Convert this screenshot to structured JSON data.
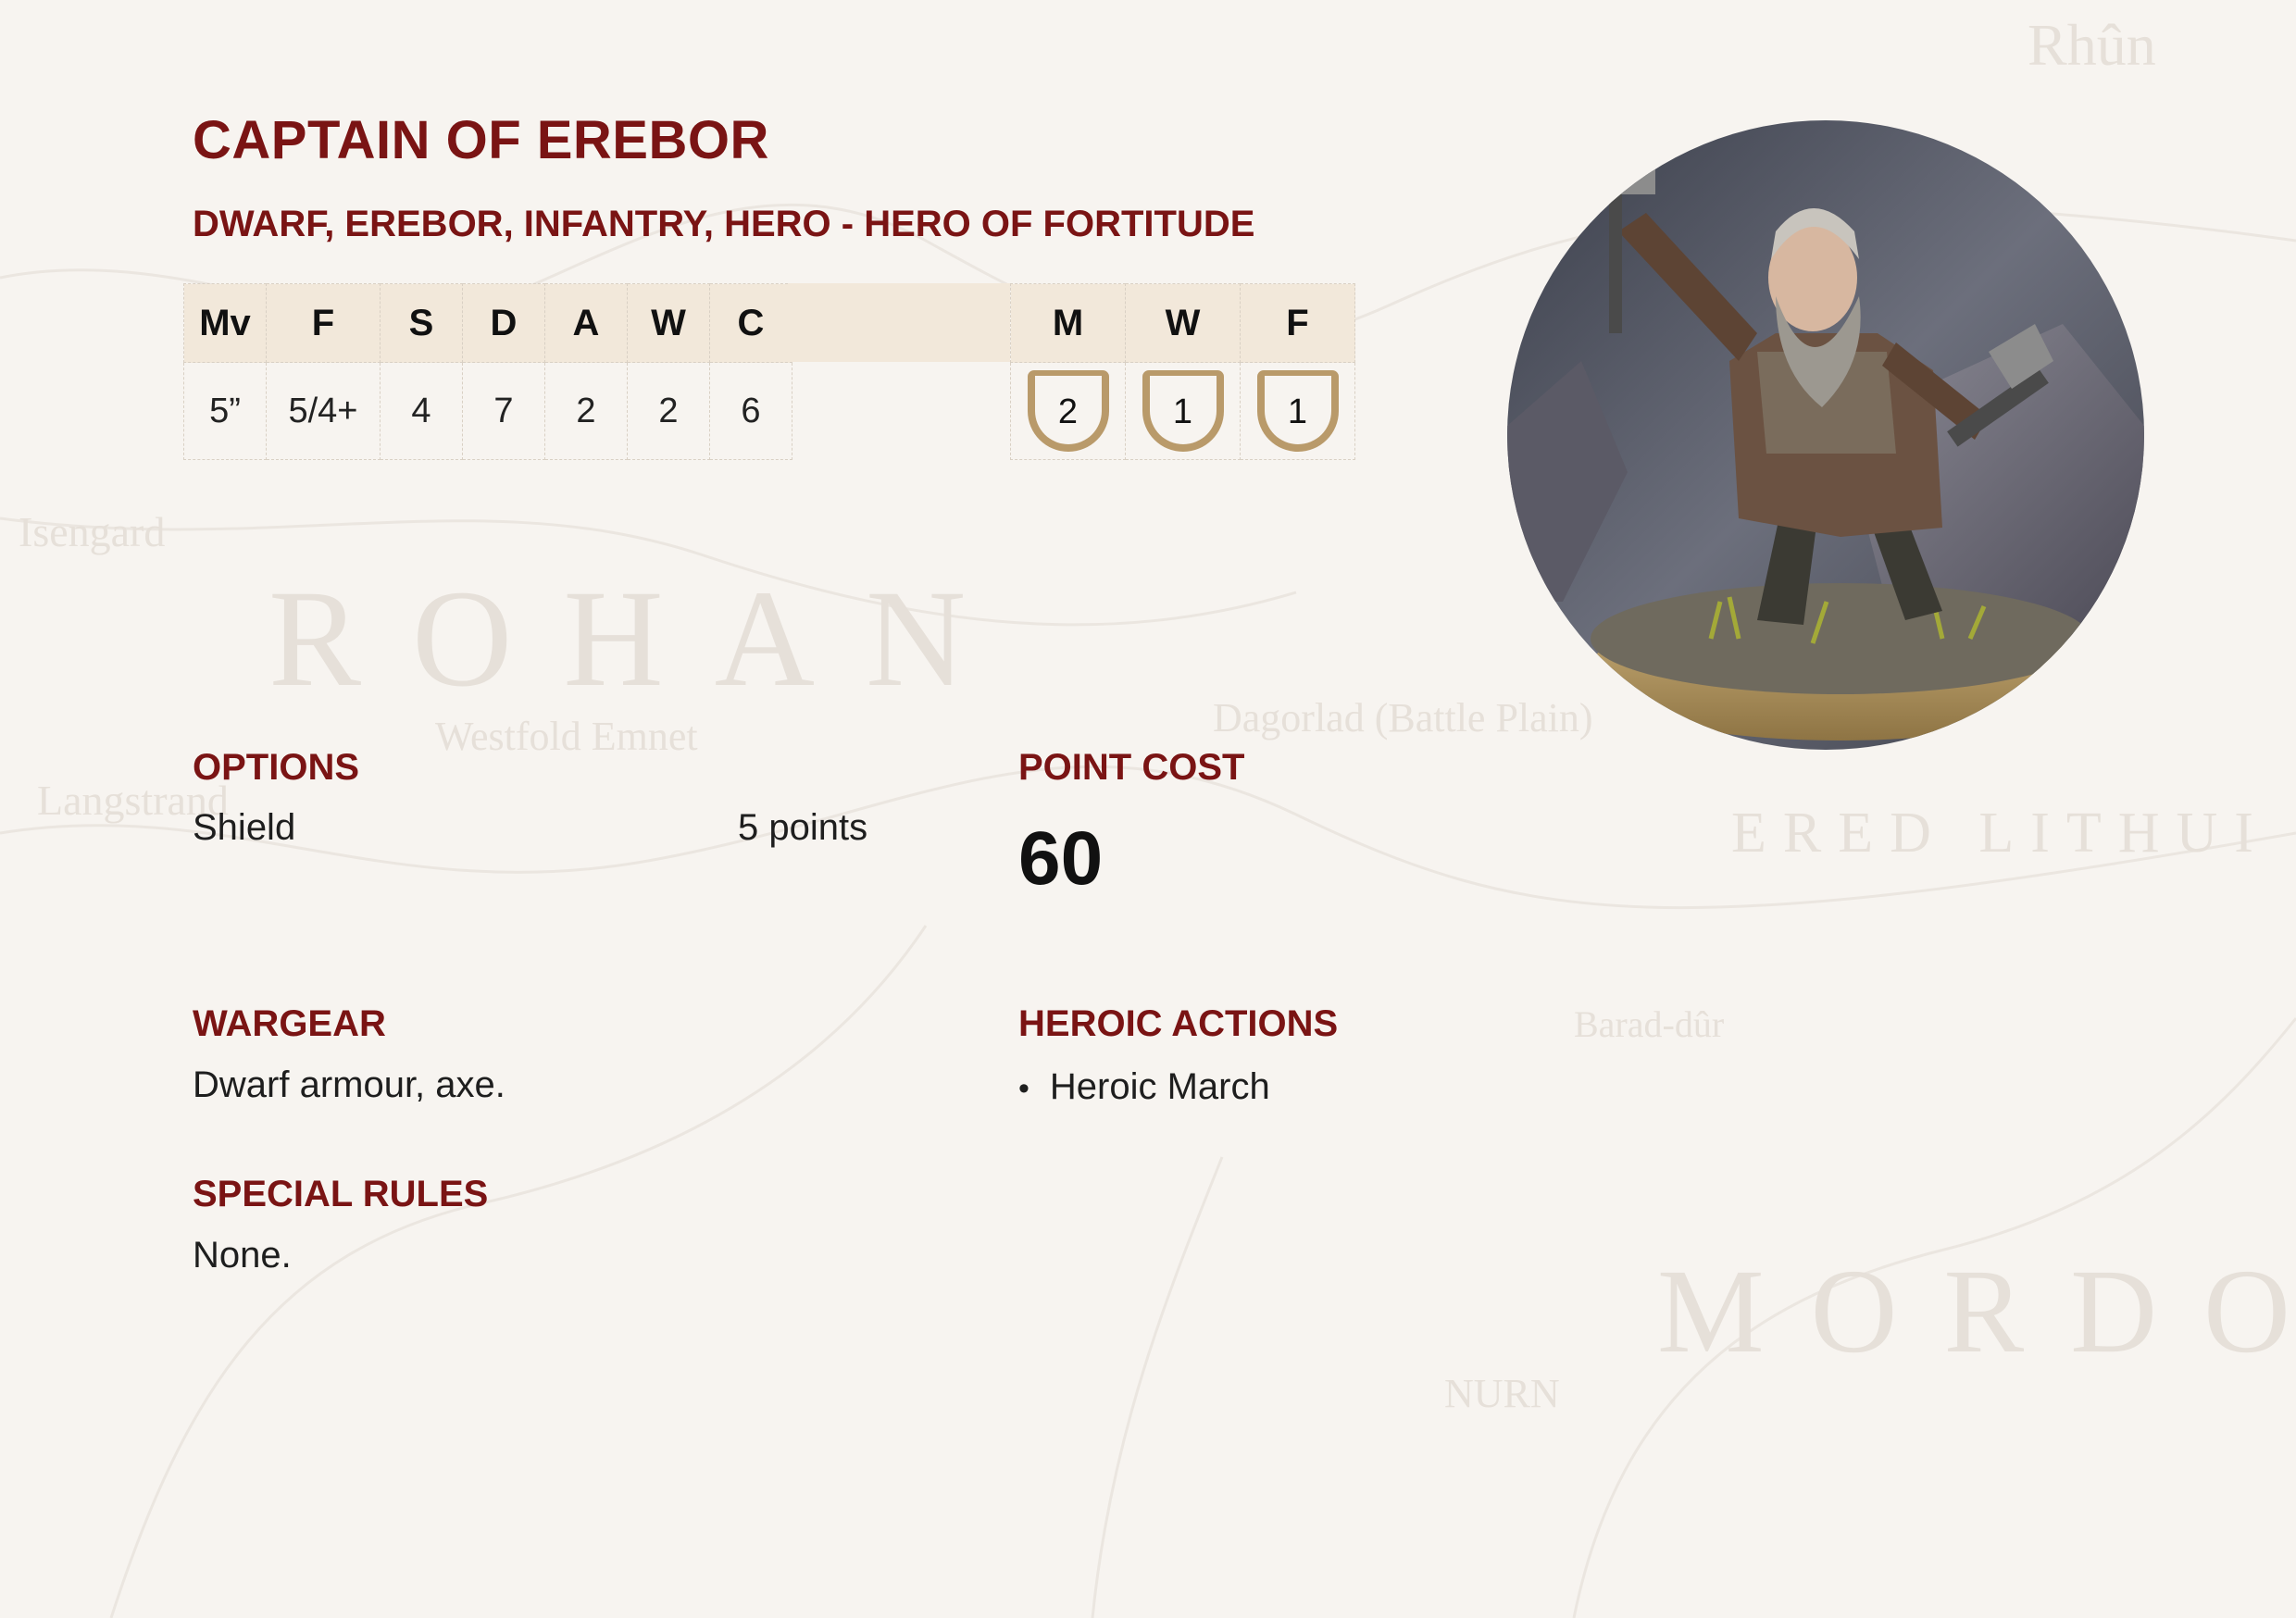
{
  "unit": {
    "name": "CAPTAIN OF EREBOR",
    "keywords": "DWARF, EREBOR, INFANTRY, HERO - HERO OF FORTITUDE"
  },
  "stats": {
    "headers": [
      "Mv",
      "F",
      "S",
      "D",
      "A",
      "W",
      "C"
    ],
    "values": [
      "5”",
      "5/4+",
      "4",
      "7",
      "2",
      "2",
      "6"
    ]
  },
  "hero_stats": {
    "headers": [
      "M",
      "W",
      "F"
    ],
    "values": [
      "2",
      "1",
      "1"
    ]
  },
  "options": {
    "heading": "OPTIONS",
    "items": [
      {
        "name": "Shield",
        "cost": "5 points"
      }
    ]
  },
  "point_cost": {
    "heading": "POINT COST",
    "value": "60"
  },
  "wargear": {
    "heading": "WARGEAR",
    "text": "Dwarf armour, axe."
  },
  "heroic_actions": {
    "heading": "HEROIC ACTIONS",
    "items": [
      "Heroic March"
    ]
  },
  "special_rules": {
    "heading": "SPECIAL RULES",
    "text": "None."
  },
  "colors": {
    "heading_red": "#7a1414",
    "table_header": "#f2e8da",
    "shield_outline": "#b99a6a",
    "page_background": "#f7f4f0"
  }
}
